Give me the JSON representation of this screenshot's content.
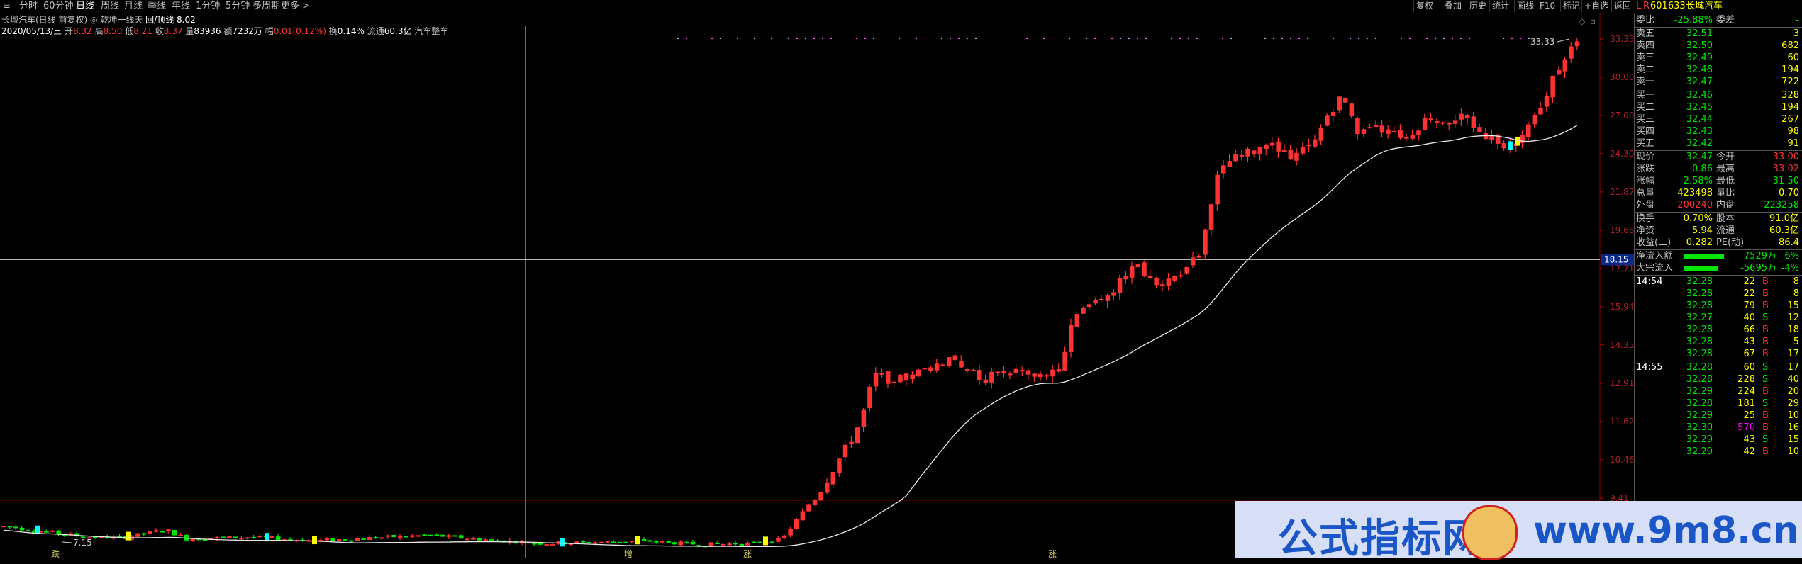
{
  "topbar": {
    "left_icon": "≡",
    "tabs": [
      "分时",
      "60分钟",
      "日线",
      "周线",
      "月线",
      "季线",
      "年线",
      "1分钟",
      "5分钟",
      "多周期",
      "更多 >"
    ],
    "active_tab": "日线",
    "right_buttons": [
      "复权",
      "叠加",
      "历史",
      "统计",
      "画线",
      "F10",
      "标记",
      "+自选",
      "返回"
    ]
  },
  "info": {
    "title": "长城汽车(日线 前复权)",
    "indicator": "乾坤一线天",
    "ma_label": "回/顶线",
    "ma_value": "8.02",
    "date": "2020/05/13/三",
    "open_label": "开",
    "open": "8.32",
    "high_label": "高",
    "high": "8.50",
    "low_label": "低",
    "low": "8.21",
    "close_label": "收",
    "close": "8.37",
    "vol_label": "量",
    "vol": "83936",
    "amount_label": "额",
    "amount": "7232万",
    "change_label": "幅",
    "change": "0.01(0.12%)",
    "turnover_label": "换",
    "turnover": "0.14%",
    "float_label": "流通",
    "float": "60.3亿",
    "sector": "汽车整车"
  },
  "price_axis": [
    "33.33",
    "30.00",
    "27.00",
    "24.30",
    "21.87",
    "19.68",
    "17.71",
    "15.94",
    "14.35",
    "12.91",
    "11.62",
    "10.46",
    "9.41"
  ],
  "crosshair_price": "18.15",
  "peak_label": "33.33",
  "low_label_chart": "7.15",
  "bottom_labels": [
    "跌",
    "增",
    "涨",
    "涨"
  ],
  "chart_data": {
    "type": "candlestick",
    "title": "长城汽车(日线 前复权)",
    "ylim": [
      9.41,
      33.33
    ],
    "log_scale": true,
    "series": [
      {
        "name": "乾坤一线天",
        "note": "trend line"
      }
    ],
    "max_price": 33.33,
    "min_price": 7.15,
    "crosshair_price": 18.15
  },
  "stock": {
    "code": "601633",
    "name": "长城汽车",
    "weibi_label": "委比",
    "weibi": "-25.88%",
    "weicha_label": "委差",
    "weicha": "-",
    "asks": [
      {
        "label": "卖五",
        "price": "32.51",
        "vol": "3"
      },
      {
        "label": "卖四",
        "price": "32.50",
        "vol": "682"
      },
      {
        "label": "卖三",
        "price": "32.49",
        "vol": "60"
      },
      {
        "label": "卖二",
        "price": "32.48",
        "vol": "194"
      },
      {
        "label": "卖一",
        "price": "32.47",
        "vol": "722"
      }
    ],
    "bids": [
      {
        "label": "买一",
        "price": "32.46",
        "vol": "328"
      },
      {
        "label": "买二",
        "price": "32.45",
        "vol": "194"
      },
      {
        "label": "买三",
        "price": "32.44",
        "vol": "267"
      },
      {
        "label": "买四",
        "price": "32.43",
        "vol": "98"
      },
      {
        "label": "买五",
        "price": "32.42",
        "vol": "91"
      }
    ],
    "stats": [
      {
        "l1": "现价",
        "v1": "32.47",
        "l2": "今开",
        "v2": "33.00"
      },
      {
        "l1": "涨跌",
        "v1": "-0.86",
        "l2": "最高",
        "v2": "33.02"
      },
      {
        "l1": "涨幅",
        "v1": "-2.58%",
        "l2": "最低",
        "v2": "31.50"
      },
      {
        "l1": "总量",
        "v1": "423498",
        "l2": "量比",
        "v2": "0.70"
      },
      {
        "l1": "外盘",
        "v1": "200240",
        "l2": "内盘",
        "v2": "223258"
      }
    ],
    "stats2": [
      {
        "l1": "换手",
        "v1": "0.70%",
        "l2": "股本",
        "v2": "91.0亿"
      },
      {
        "l1": "净资",
        "v1": "5.94",
        "l2": "流通",
        "v2": "60.3亿"
      },
      {
        "l1": "收益(二)",
        "v1": "0.282",
        "l2": "PE(动)",
        "v2": "86.4"
      }
    ],
    "flows": [
      {
        "label": "净流入额",
        "value": "-7529万",
        "pct": "-6%"
      },
      {
        "label": "大宗流入",
        "value": "-5695万",
        "pct": "-4%"
      }
    ],
    "ticks1_time": "14:54",
    "ticks1": [
      {
        "p": "32.28",
        "v": "22",
        "d": "B",
        "n": "8"
      },
      {
        "p": "32.28",
        "v": "22",
        "d": "B",
        "n": "8"
      },
      {
        "p": "32.28",
        "v": "79",
        "d": "B",
        "n": "15"
      },
      {
        "p": "32.27",
        "v": "40",
        "d": "S",
        "n": "12"
      },
      {
        "p": "32.28",
        "v": "66",
        "d": "B",
        "n": "18"
      },
      {
        "p": "32.28",
        "v": "43",
        "d": "B",
        "n": "5"
      },
      {
        "p": "32.28",
        "v": "67",
        "d": "B",
        "n": "17"
      }
    ],
    "ticks2_time": "14:55",
    "ticks2": [
      {
        "p": "32.28",
        "v": "60",
        "d": "S",
        "n": "17"
      },
      {
        "p": "32.28",
        "v": "228",
        "d": "S",
        "n": "40"
      },
      {
        "p": "32.29",
        "v": "224",
        "d": "B",
        "n": "20"
      },
      {
        "p": "32.28",
        "v": "181",
        "d": "S",
        "n": "29"
      },
      {
        "p": "32.29",
        "v": "25",
        "d": "B",
        "n": "10"
      },
      {
        "p": "32.30",
        "v": "570",
        "d": "B",
        "n": "16"
      },
      {
        "p": "32.29",
        "v": "43",
        "d": "S",
        "n": "15"
      },
      {
        "p": "32.29",
        "v": "42",
        "d": "B",
        "n": "10"
      }
    ]
  },
  "watermark": {
    "text1": "公式指标网",
    "text2": "www.9m8.cn"
  },
  "colors": {
    "up": "#ff3232",
    "down": "#00e600",
    "ma": "#e8e8e8",
    "axis": "#b00000"
  }
}
